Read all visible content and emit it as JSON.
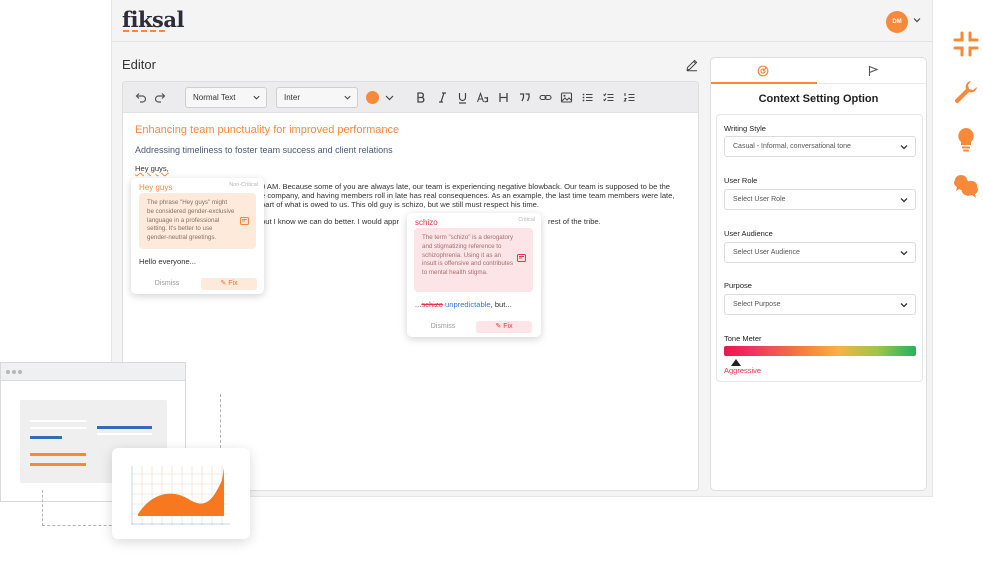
{
  "app": {
    "logo": "fiksal",
    "avatar_initials": "DM"
  },
  "editor": {
    "title": "Editor",
    "toolbar": {
      "style_select": "Normal Text",
      "font_select": "Inter",
      "accent_color": "#f7893b"
    },
    "doc": {
      "heading": "Enhancing team punctuality for improved performance",
      "subheading": "Addressing timeliness to foster team success and client relations",
      "greeting": "Hey guys,",
      "line1": "0 AM. Because some of you are always late, our team is experiencing negative blowback. Our team is supposed to be the",
      "line2": "e company, and having members roll in late has real consequences. As an example, the last time team members were late,",
      "line3": "part of what is owed to us. This old guy is schizo, but we still must respect his time.",
      "line4_left": "but I know we can do better. I would appr",
      "line4_right": "rest of the tribe."
    },
    "card1": {
      "title": "Hey guys",
      "severity": "Non-Critical",
      "explanation": "The phrase \"Hey guys\" might be considered gender-exclusive language in a professional setting. It's better to use gender-neutral greetings.",
      "suggestion": "Hello everyone...",
      "dismiss": "Dismiss",
      "fix": "Fix"
    },
    "card2": {
      "title": "schizo",
      "severity": "Critical",
      "explanation": "The term \"schizo\" is a derogatory and stigmatizing reference to schizophrenia. Using it as an insult is offensive and contributes to mental health stigma.",
      "sugg_prefix": "...",
      "sugg_strike": "schizo",
      "sugg_new": "unpredictable",
      "sugg_suffix": ", but...",
      "dismiss": "Dismiss",
      "fix": "Fix"
    }
  },
  "sidebar": {
    "title": "Context Setting Option",
    "fields": {
      "writing_style": {
        "label": "Writing Style",
        "value": "Casual - Informal, conversational tone"
      },
      "user_role": {
        "label": "User Role",
        "placeholder": "Select User Role"
      },
      "user_audience": {
        "label": "User Audience",
        "placeholder": "Select User Audience"
      },
      "purpose": {
        "label": "Purpose",
        "placeholder": "Select Purpose"
      }
    },
    "tone": {
      "label": "Tone Meter",
      "value_label": "Aggressive",
      "level": 0.07
    }
  },
  "colors": {
    "accent": "#f7893b",
    "critical": "#e8344d",
    "link": "#2f7bd8"
  }
}
